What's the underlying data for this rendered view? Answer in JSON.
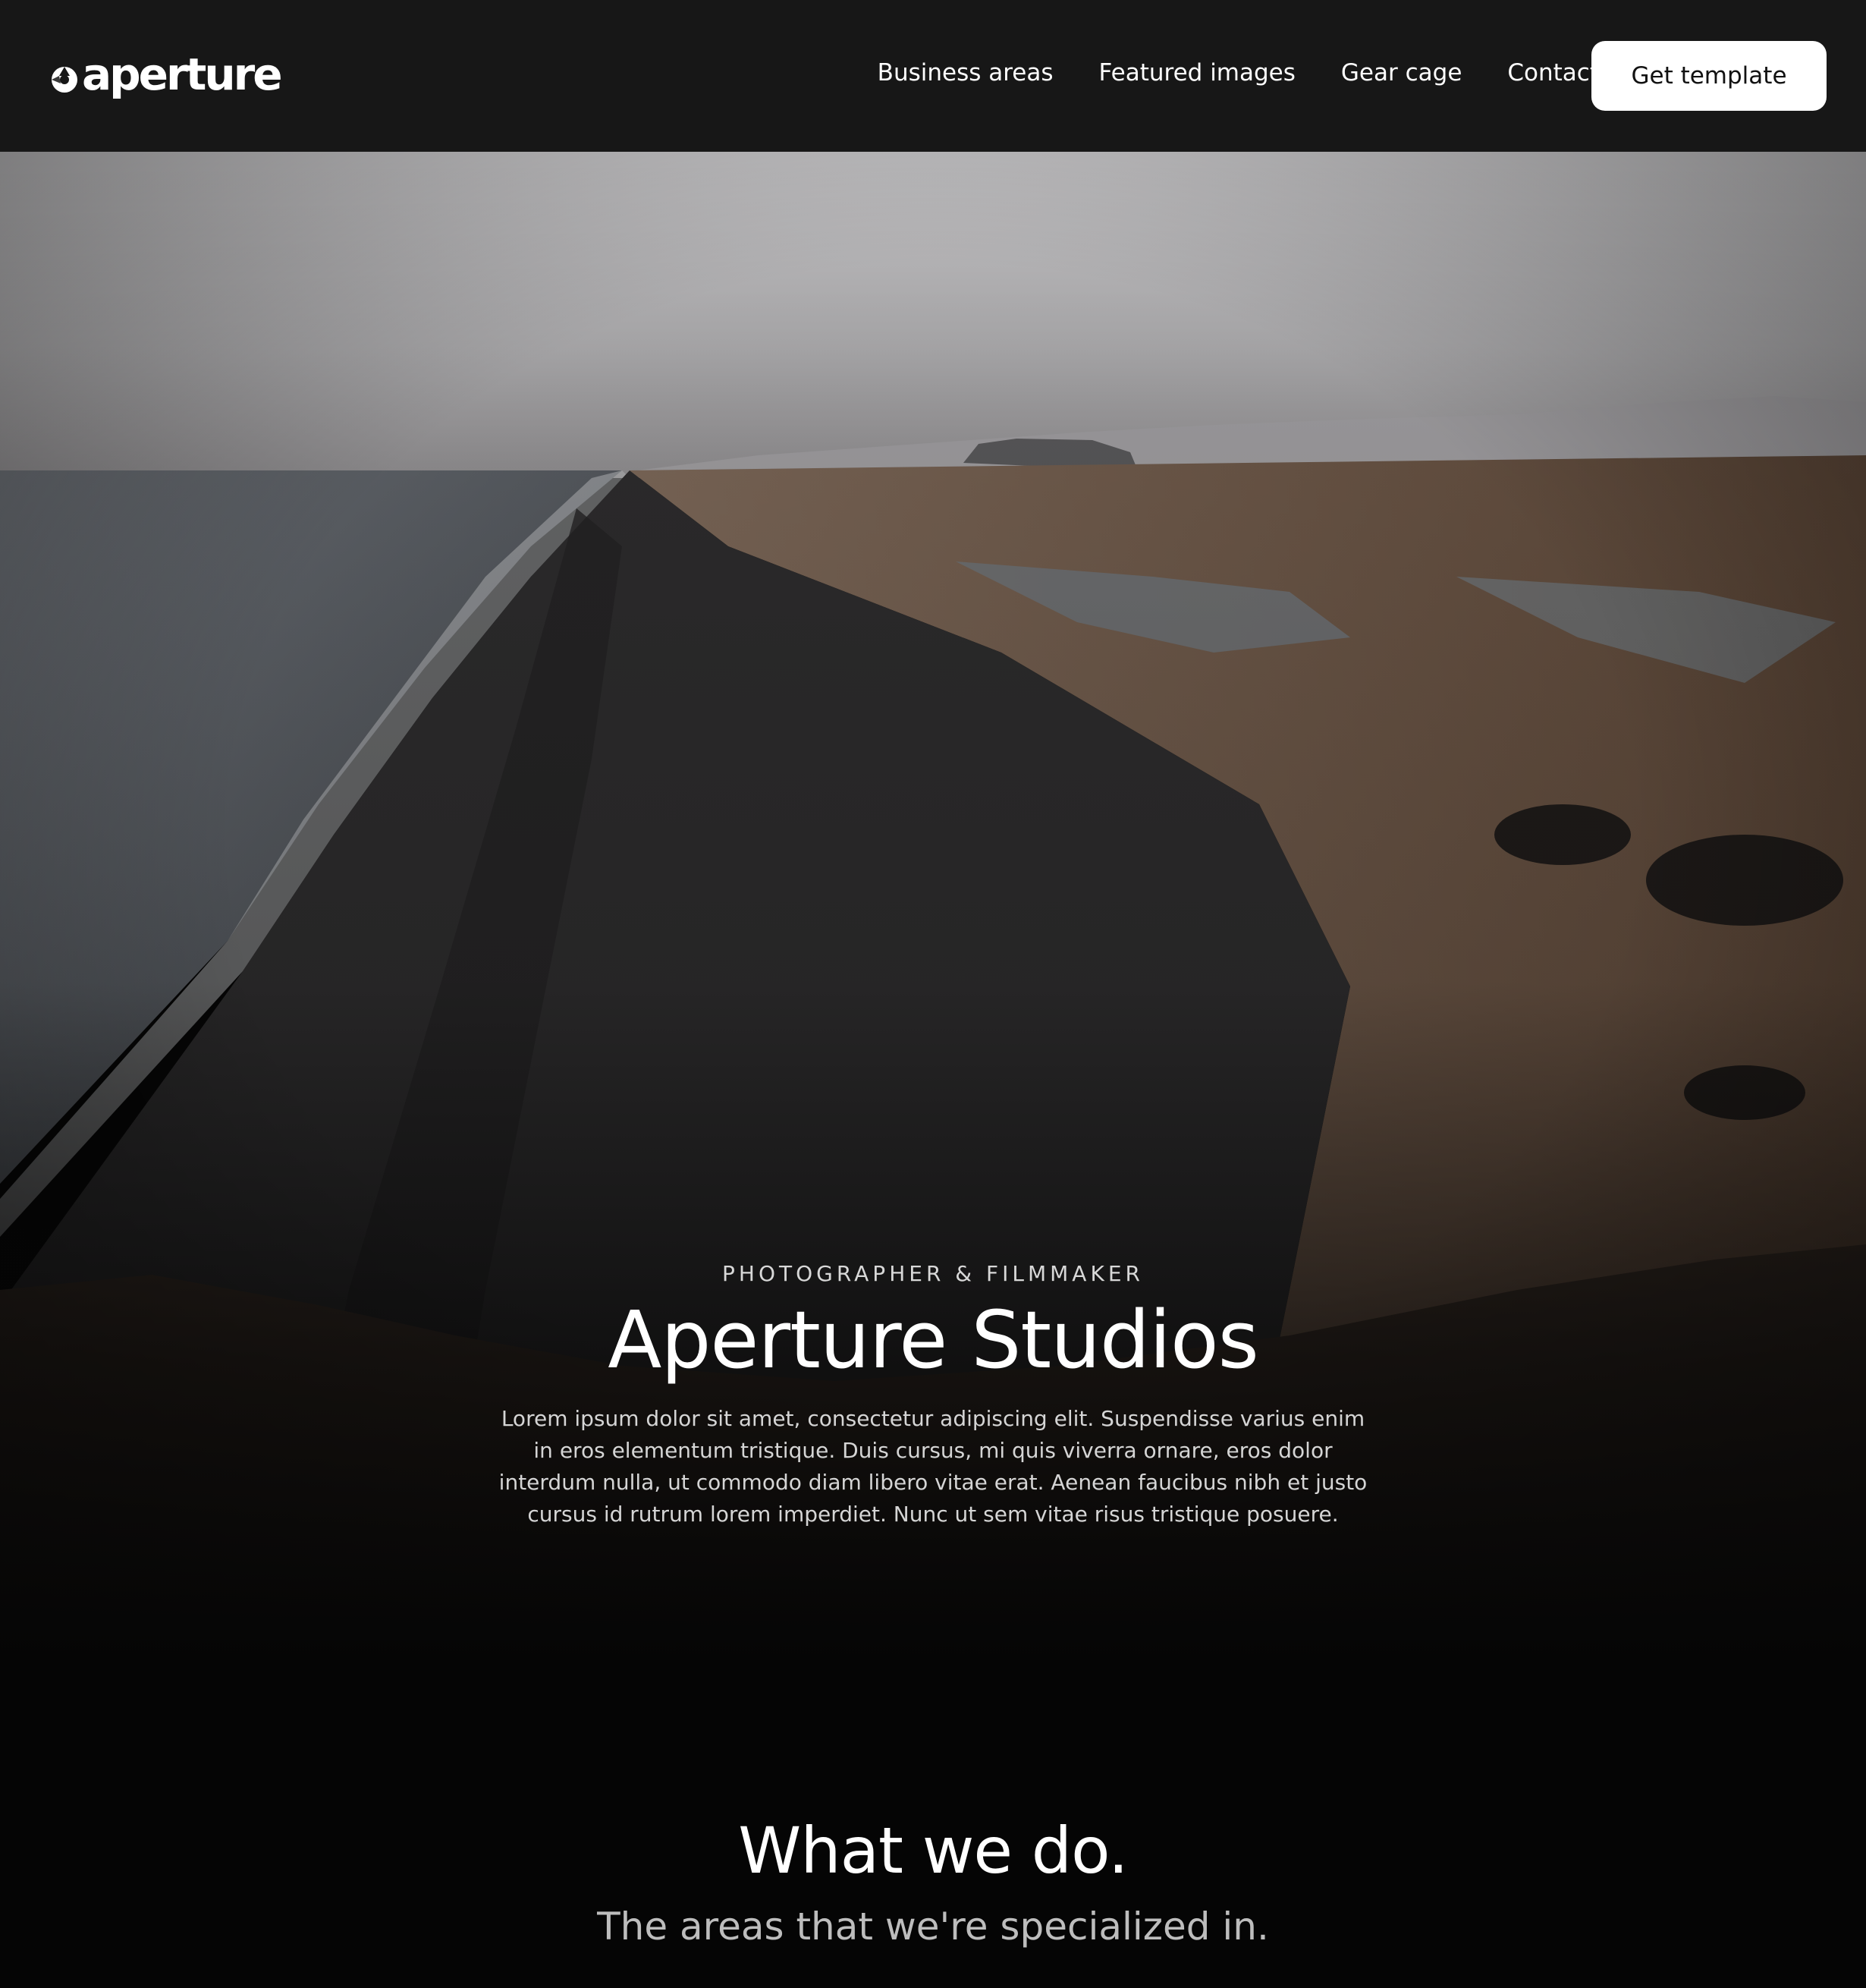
{
  "nav": {
    "logo_text": "aperture",
    "links": [
      "Business areas",
      "Featured images",
      "Gear cage",
      "Contact"
    ],
    "cta_label": "Get template"
  },
  "hero": {
    "eyebrow": "PHOTOGRAPHER & FILMMAKER",
    "title": "Aperture Studios",
    "description": "Lorem ipsum dolor sit amet, consectetur adipiscing elit. Suspendisse varius enim in eros elementum tristique. Duis cursus, mi quis viverra ornare, eros dolor interdum nulla, ut commodo diam libero vitae erat. Aenean faucibus nibh et justo cursus id rutrum lorem imperdiet. Nunc ut sem vitae risus tristique posuere."
  },
  "section": {
    "title": "What we do.",
    "subtitle": "The areas that we're specialized in."
  },
  "colors": {
    "navbar_bg": "#171717",
    "page_bg": "#050505",
    "cta_bg": "#ffffff",
    "cta_text": "#111111"
  },
  "icons": {
    "logo_mark": "aperture-logo-icon"
  }
}
